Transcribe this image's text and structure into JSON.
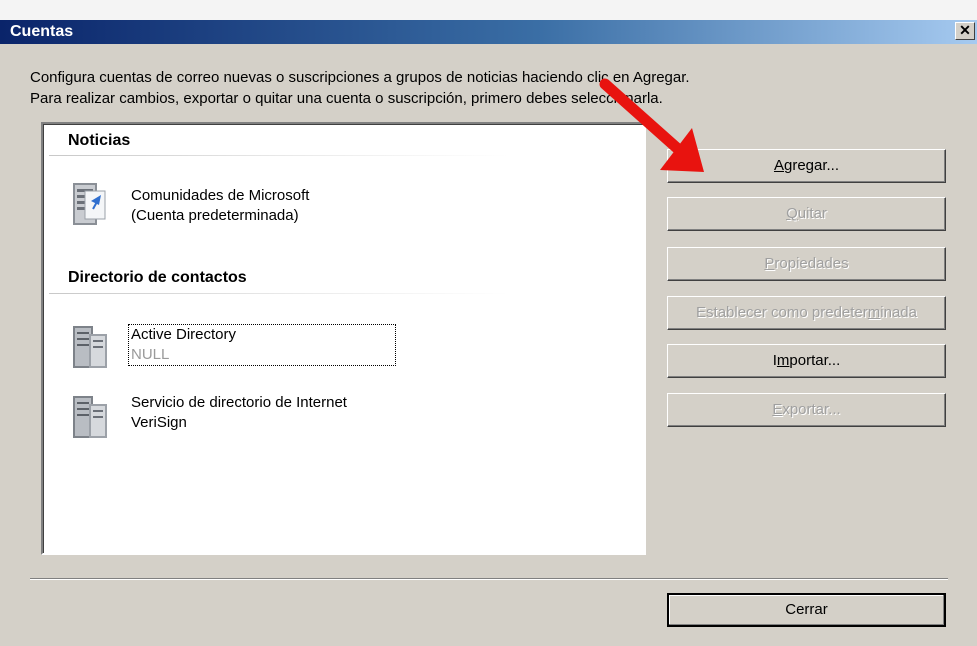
{
  "window": {
    "title": "Cuentas",
    "close_glyph": "✕"
  },
  "instructions": {
    "line1": "Configura cuentas de correo nuevas o suscripciones a grupos de noticias haciendo clic en Agregar.",
    "line2": "Para realizar cambios, exportar o quitar una cuenta o suscripción, primero debes seleccionarla."
  },
  "groups": [
    {
      "header": "Noticias",
      "items": [
        {
          "line1": "Comunidades de Microsoft",
          "line2": "(Cuenta predeterminada)",
          "icon": "news-account-icon"
        }
      ]
    },
    {
      "header": "Directorio de contactos",
      "items": [
        {
          "line1": "Active Directory",
          "line2": "NULL",
          "icon": "server-icon"
        },
        {
          "line1": "Servicio de directorio de Internet",
          "line2": "VeriSign",
          "icon": "server-icon"
        }
      ]
    }
  ],
  "buttons": {
    "agregar": {
      "pre": "",
      "key": "A",
      "post": "gregar...",
      "enabled": true
    },
    "quitar": {
      "pre": "",
      "key": "Q",
      "post": "uitar",
      "enabled": false
    },
    "propiedades": {
      "pre": "",
      "key": "P",
      "post": "ropiedades",
      "enabled": false
    },
    "predeterminada": {
      "pre": "Establecer como predeter",
      "key": "m",
      "post": "inada",
      "enabled": false
    },
    "importar": {
      "pre": "I",
      "key": "m",
      "post": "portar...",
      "enabled": true
    },
    "exportar": {
      "pre": "",
      "key": "E",
      "post": "xportar...",
      "enabled": false
    },
    "cerrar": {
      "label": "Cerrar",
      "enabled": true
    }
  },
  "annotation": {
    "color": "#e8130f",
    "icon": "red-arrow-icon"
  }
}
